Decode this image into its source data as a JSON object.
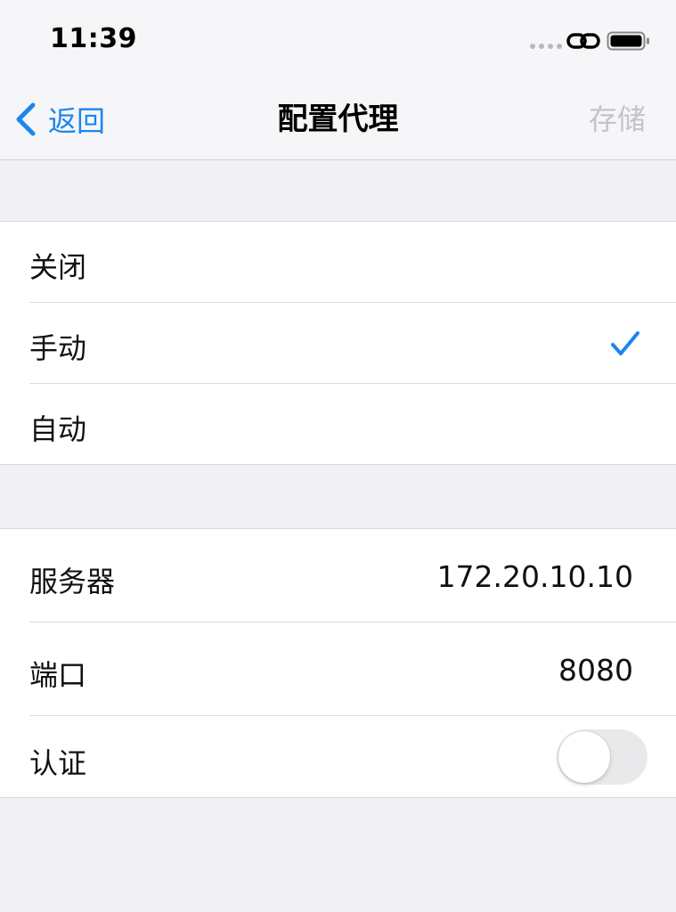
{
  "status_bar": {
    "time": "11:39",
    "icons": [
      "signal-dots-icon",
      "link-icon",
      "battery-icon"
    ]
  },
  "nav": {
    "back_label": "返回",
    "title": "配置代理",
    "save_label": "存储",
    "accent_color": "#1a86f0",
    "save_disabled_color": "#c4c4c8"
  },
  "mode": {
    "options": [
      {
        "label": "关闭",
        "selected": false
      },
      {
        "label": "手动",
        "selected": true
      },
      {
        "label": "自动",
        "selected": false
      }
    ]
  },
  "server": {
    "server_label": "服务器",
    "server_value": "172.20.10.10",
    "port_label": "端口",
    "port_value": "8080",
    "auth_label": "认证",
    "auth_enabled": false
  }
}
